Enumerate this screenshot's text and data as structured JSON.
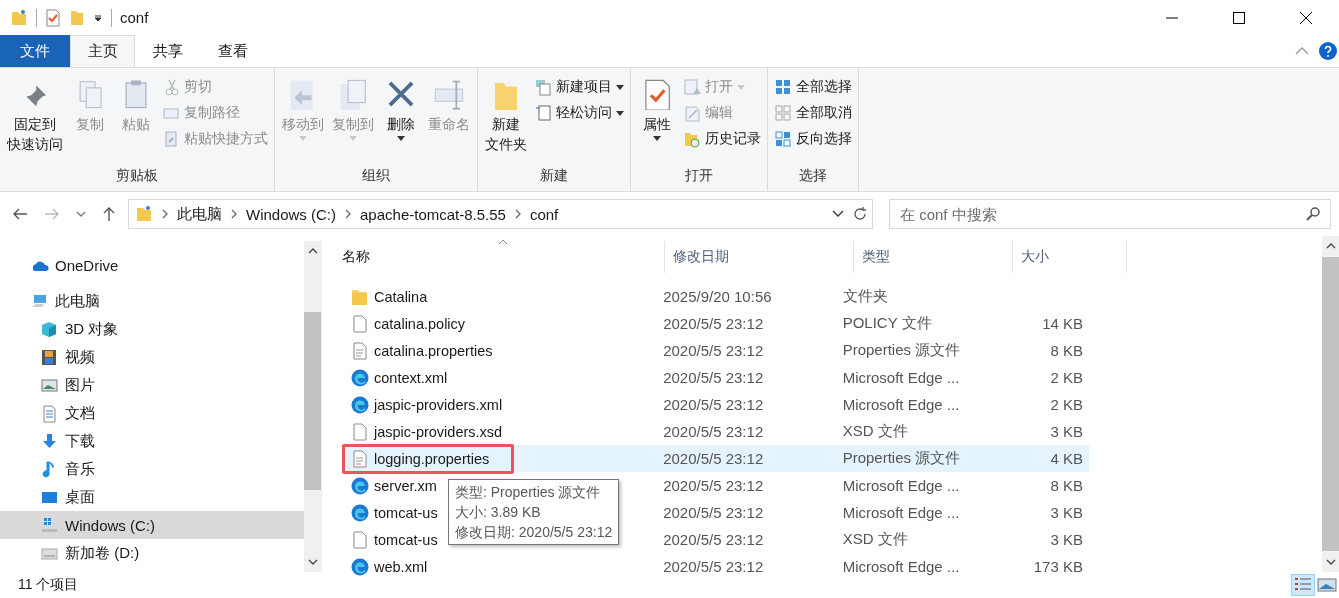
{
  "title_bar": {
    "title": "conf"
  },
  "ribbon_tabs": [
    {
      "label": "文件",
      "kind": "file",
      "selected": false
    },
    {
      "label": "主页",
      "kind": "tab",
      "selected": true
    },
    {
      "label": "共享",
      "kind": "tab",
      "selected": false
    },
    {
      "label": "查看",
      "kind": "tab",
      "selected": false
    }
  ],
  "ribbon_groups": [
    {
      "label": "剪贴板",
      "items": [
        {
          "kind": "large",
          "lines": [
            "固定到",
            "快速访问"
          ],
          "disabled": false,
          "menu": false
        },
        {
          "kind": "large",
          "lines": [
            "复制"
          ],
          "disabled": true,
          "menu": false
        },
        {
          "kind": "large",
          "lines": [
            "粘贴"
          ],
          "disabled": true,
          "menu": false
        },
        {
          "kind": "small",
          "label": "剪切",
          "disabled": true,
          "menu": false
        },
        {
          "kind": "small",
          "label": "复制路径",
          "disabled": true,
          "menu": false
        },
        {
          "kind": "small",
          "label": "粘贴快捷方式",
          "disabled": true,
          "menu": false
        }
      ]
    },
    {
      "label": "组织",
      "items": [
        {
          "kind": "large",
          "lines": [
            "移动到"
          ],
          "disabled": true,
          "menu": true
        },
        {
          "kind": "large",
          "lines": [
            "复制到"
          ],
          "disabled": true,
          "menu": true
        },
        {
          "kind": "large",
          "lines": [
            "删除"
          ],
          "disabled": false,
          "menu": true
        },
        {
          "kind": "large",
          "lines": [
            "重命名"
          ],
          "disabled": true,
          "menu": false
        }
      ]
    },
    {
      "label": "新建",
      "items": [
        {
          "kind": "large",
          "lines": [
            "新建",
            "文件夹"
          ],
          "disabled": false,
          "menu": false
        },
        {
          "kind": "small",
          "label": "新建项目",
          "disabled": false,
          "menu": true
        },
        {
          "kind": "small",
          "label": "轻松访问",
          "disabled": false,
          "menu": true
        }
      ]
    },
    {
      "label": "打开",
      "items": [
        {
          "kind": "large",
          "lines": [
            "属性"
          ],
          "disabled": false,
          "menu": true
        },
        {
          "kind": "small",
          "label": "打开",
          "disabled": true,
          "menu": true
        },
        {
          "kind": "small",
          "label": "编辑",
          "disabled": true,
          "menu": false
        },
        {
          "kind": "small",
          "label": "历史记录",
          "disabled": false,
          "menu": false
        }
      ]
    },
    {
      "label": "选择",
      "items": [
        {
          "kind": "small",
          "label": "全部选择",
          "disabled": false,
          "menu": false
        },
        {
          "kind": "small",
          "label": "全部取消",
          "disabled": false,
          "menu": false
        },
        {
          "kind": "small",
          "label": "反向选择",
          "disabled": false,
          "menu": false
        }
      ]
    }
  ],
  "address_bar": {
    "crumbs": [
      "此电脑",
      "Windows (C:)",
      "apache-tomcat-8.5.55",
      "conf"
    ]
  },
  "search": {
    "placeholder": "在 conf 中搜索"
  },
  "sidebar": {
    "items": [
      {
        "label": "OneDrive",
        "kind": "cloud",
        "selected": false
      },
      {
        "label": "此电脑",
        "kind": "pc",
        "selected": false,
        "children": [
          {
            "label": "3D 对象",
            "kind": "cube",
            "selected": false
          },
          {
            "label": "视频",
            "kind": "video",
            "selected": false
          },
          {
            "label": "图片",
            "kind": "image",
            "selected": false
          },
          {
            "label": "文档",
            "kind": "doc",
            "selected": false
          },
          {
            "label": "下载",
            "kind": "download",
            "selected": false
          },
          {
            "label": "音乐",
            "kind": "music",
            "selected": false
          },
          {
            "label": "桌面",
            "kind": "desktop",
            "selected": false
          },
          {
            "label": "Windows (C:)",
            "kind": "drive",
            "selected": true
          },
          {
            "label": "新加卷 (D:)",
            "kind": "drive2",
            "selected": false
          }
        ]
      }
    ]
  },
  "table": {
    "columns": [
      {
        "label": "名称",
        "sorted": true
      },
      {
        "label": "修改日期",
        "sorted": false
      },
      {
        "label": "类型",
        "sorted": false
      },
      {
        "label": "大小",
        "sorted": false
      }
    ],
    "rows": [
      {
        "kind": "folder",
        "name": "Catalina",
        "date": "2025/9/20 10:56",
        "type": "文件夹",
        "selected": false,
        "boxed": false
      },
      {
        "kind": "file",
        "name": "catalina.policy",
        "date": "2020/5/5 23:12",
        "type": "POLICY 文件",
        "size": "14 KB",
        "selected": false,
        "boxed": false
      },
      {
        "kind": "text",
        "name": "catalina.properties",
        "date": "2020/5/5 23:12",
        "type": "Properties 源文件",
        "size": "8 KB",
        "selected": false,
        "boxed": false
      },
      {
        "kind": "edge",
        "name": "context.xml",
        "date": "2020/5/5 23:12",
        "type": "Microsoft Edge ...",
        "size": "2 KB",
        "selected": false,
        "boxed": false
      },
      {
        "kind": "edge",
        "name": "jaspic-providers.xml",
        "date": "2020/5/5 23:12",
        "type": "Microsoft Edge ...",
        "size": "2 KB",
        "selected": false,
        "boxed": false
      },
      {
        "kind": "file",
        "name": "jaspic-providers.xsd",
        "date": "2020/5/5 23:12",
        "type": "XSD 文件",
        "size": "3 KB",
        "selected": false,
        "boxed": false
      },
      {
        "kind": "text",
        "name": "logging.properties",
        "date": "2020/5/5 23:12",
        "type": "Properties 源文件",
        "size": "4 KB",
        "selected": true,
        "boxed": true
      },
      {
        "kind": "edge",
        "name": "server.xm",
        "date": "2020/5/5 23:12",
        "type": "Microsoft Edge ...",
        "size": "8 KB",
        "selected": false,
        "boxed": false
      },
      {
        "kind": "edge",
        "name": "tomcat-us",
        "date": "2020/5/5 23:12",
        "type": "Microsoft Edge ...",
        "size": "3 KB",
        "selected": false,
        "boxed": false
      },
      {
        "kind": "file",
        "name": "tomcat-us",
        "date": "2020/5/5 23:12",
        "type": "XSD 文件",
        "size": "3 KB",
        "selected": false,
        "boxed": false
      },
      {
        "kind": "edge",
        "name": "web.xml",
        "date": "2020/5/5 23:12",
        "type": "Microsoft Edge ...",
        "size": "173 KB",
        "selected": false,
        "boxed": false
      }
    ]
  },
  "tooltip": {
    "lines": [
      "类型: Properties 源文件",
      "大小: 3.89 KB",
      "修改日期: 2020/5/5 23:12"
    ]
  },
  "status_bar": {
    "count": "11 个项目",
    "view_buttons": [
      {
        "kind": "details",
        "selected": true
      },
      {
        "kind": "thumbs",
        "selected": false
      }
    ]
  }
}
